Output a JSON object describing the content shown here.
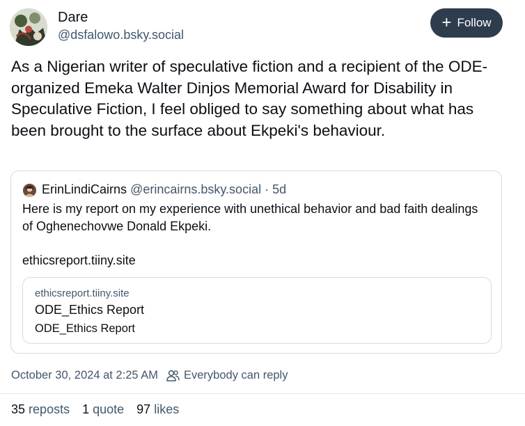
{
  "author": {
    "name": "Dare",
    "handle": "@dsfalowo.bsky.social"
  },
  "follow_button": {
    "label": "Follow",
    "icon": "plus-icon"
  },
  "post": {
    "text": "As a Nigerian writer of speculative fiction and a recipient of the ODE-organized Emeka Walter Dinjos Memorial Award for Disability in Speculative Fiction, I feel obliged to say something about what has been brought to the surface about Ekpeki's behaviour."
  },
  "quote": {
    "author_name": "ErinLindiCairns",
    "author_handle": "@erincairns.bsky.social",
    "separator": "·",
    "time": "5d",
    "text": "Here is my report on my experience with unethical behavior and bad faith dealings of Oghenechovwe Donald Ekpeki.",
    "link_text": "ethicsreport.tiiny.site",
    "link_card": {
      "domain": "ethicsreport.tiiny.site",
      "title": "ODE_Ethics Report",
      "description": "ODE_Ethics Report"
    }
  },
  "meta": {
    "timestamp": "October 30, 2024 at 2:25 AM",
    "reply_setting": "Everybody can reply",
    "reply_icon": "people-icon"
  },
  "stats": {
    "reposts_count": "35",
    "reposts_label": "reposts",
    "quotes_count": "1",
    "quotes_label": "quote",
    "likes_count": "97",
    "likes_label": "likes"
  },
  "colors": {
    "primary_text": "#0b0f14",
    "secondary_text": "#42576c",
    "follow_button_bg": "#2e3d4d",
    "border": "#d4dbe2"
  }
}
